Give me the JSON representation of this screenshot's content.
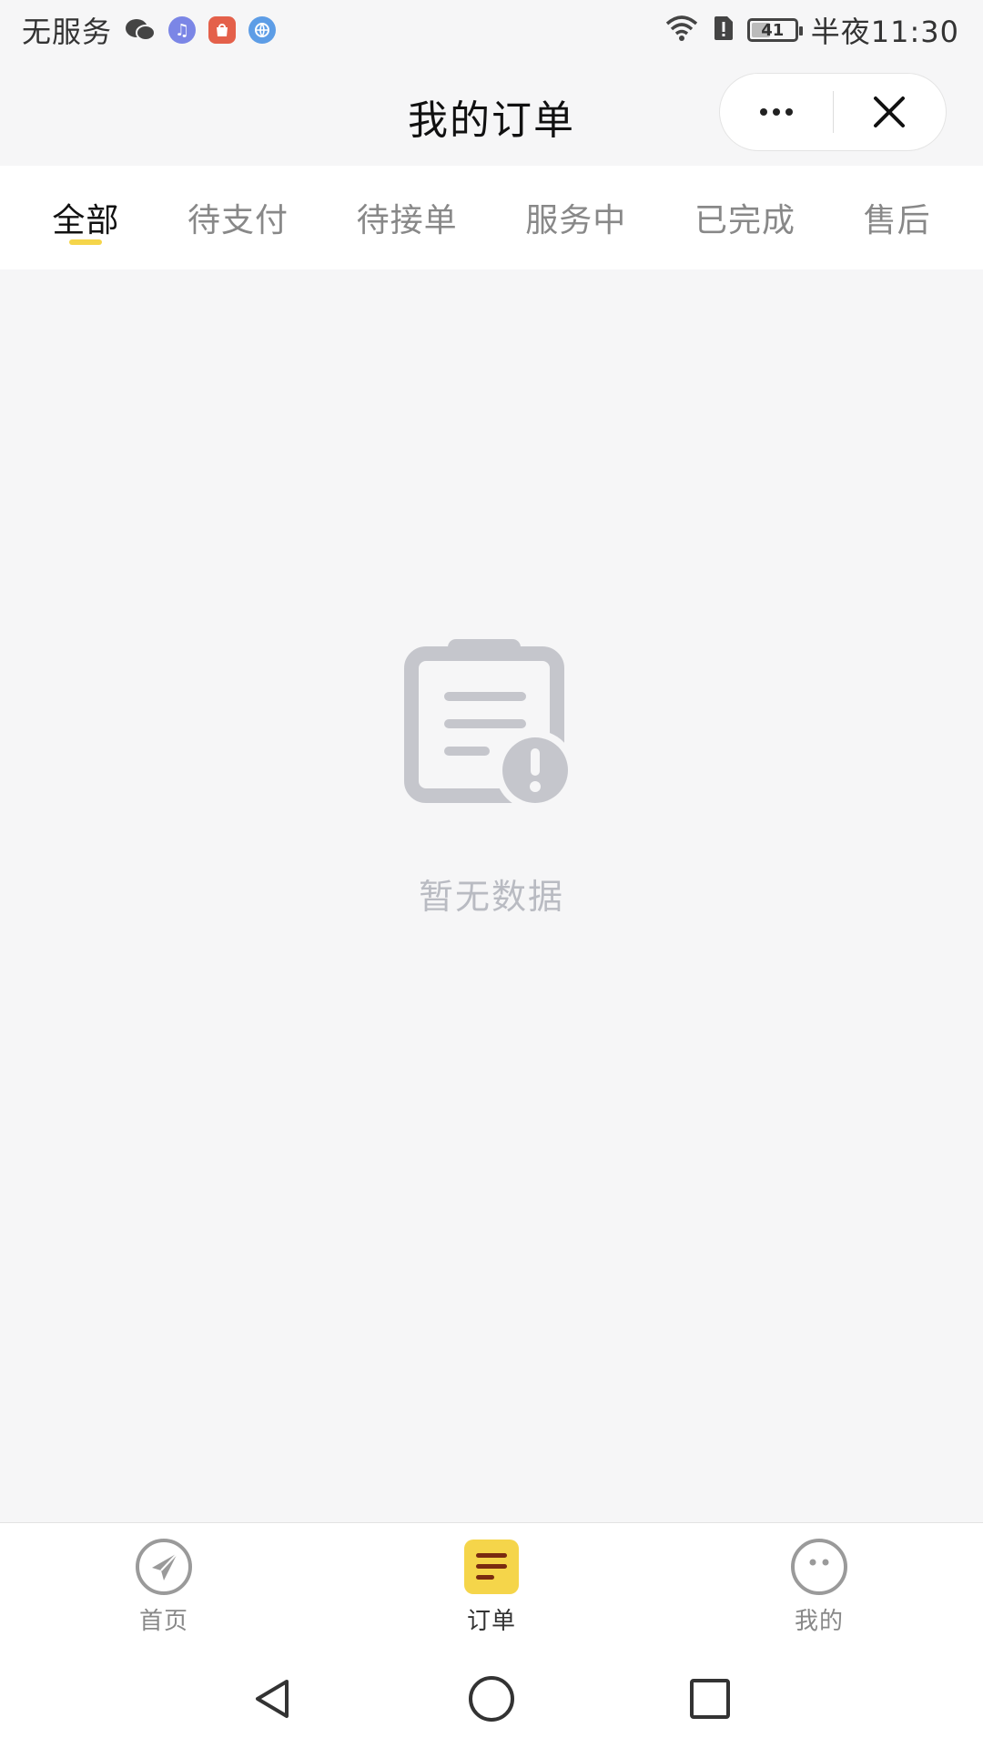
{
  "status_bar": {
    "carrier": "无服务",
    "time": "半夜11:30",
    "battery_level": "41",
    "battery_fraction": 0.41,
    "icons": [
      "wechat-icon",
      "music-icon",
      "shop-icon",
      "browser-icon",
      "wifi-icon",
      "sim-alert-icon",
      "battery-icon"
    ]
  },
  "nav": {
    "title": "我的订单",
    "more_icon": "more-dots-icon",
    "close_icon": "close-icon"
  },
  "tabs": [
    {
      "label": "全部",
      "active": true
    },
    {
      "label": "待支付",
      "active": false
    },
    {
      "label": "待接单",
      "active": false
    },
    {
      "label": "服务中",
      "active": false
    },
    {
      "label": "已完成",
      "active": false
    },
    {
      "label": "售后",
      "active": false
    }
  ],
  "empty_state": {
    "icon": "clipboard-alert-icon",
    "text": "暂无数据"
  },
  "tabbar": [
    {
      "label": "首页",
      "icon": "paper-plane-icon",
      "active": false
    },
    {
      "label": "订单",
      "icon": "order-list-icon",
      "active": true
    },
    {
      "label": "我的",
      "icon": "profile-face-icon",
      "active": false
    }
  ],
  "colors": {
    "accent": "#f5d54a",
    "background": "#f6f6f7",
    "muted_icon": "#c5c6cc",
    "tab_active": "#111111",
    "tab_inactive": "#888888"
  }
}
